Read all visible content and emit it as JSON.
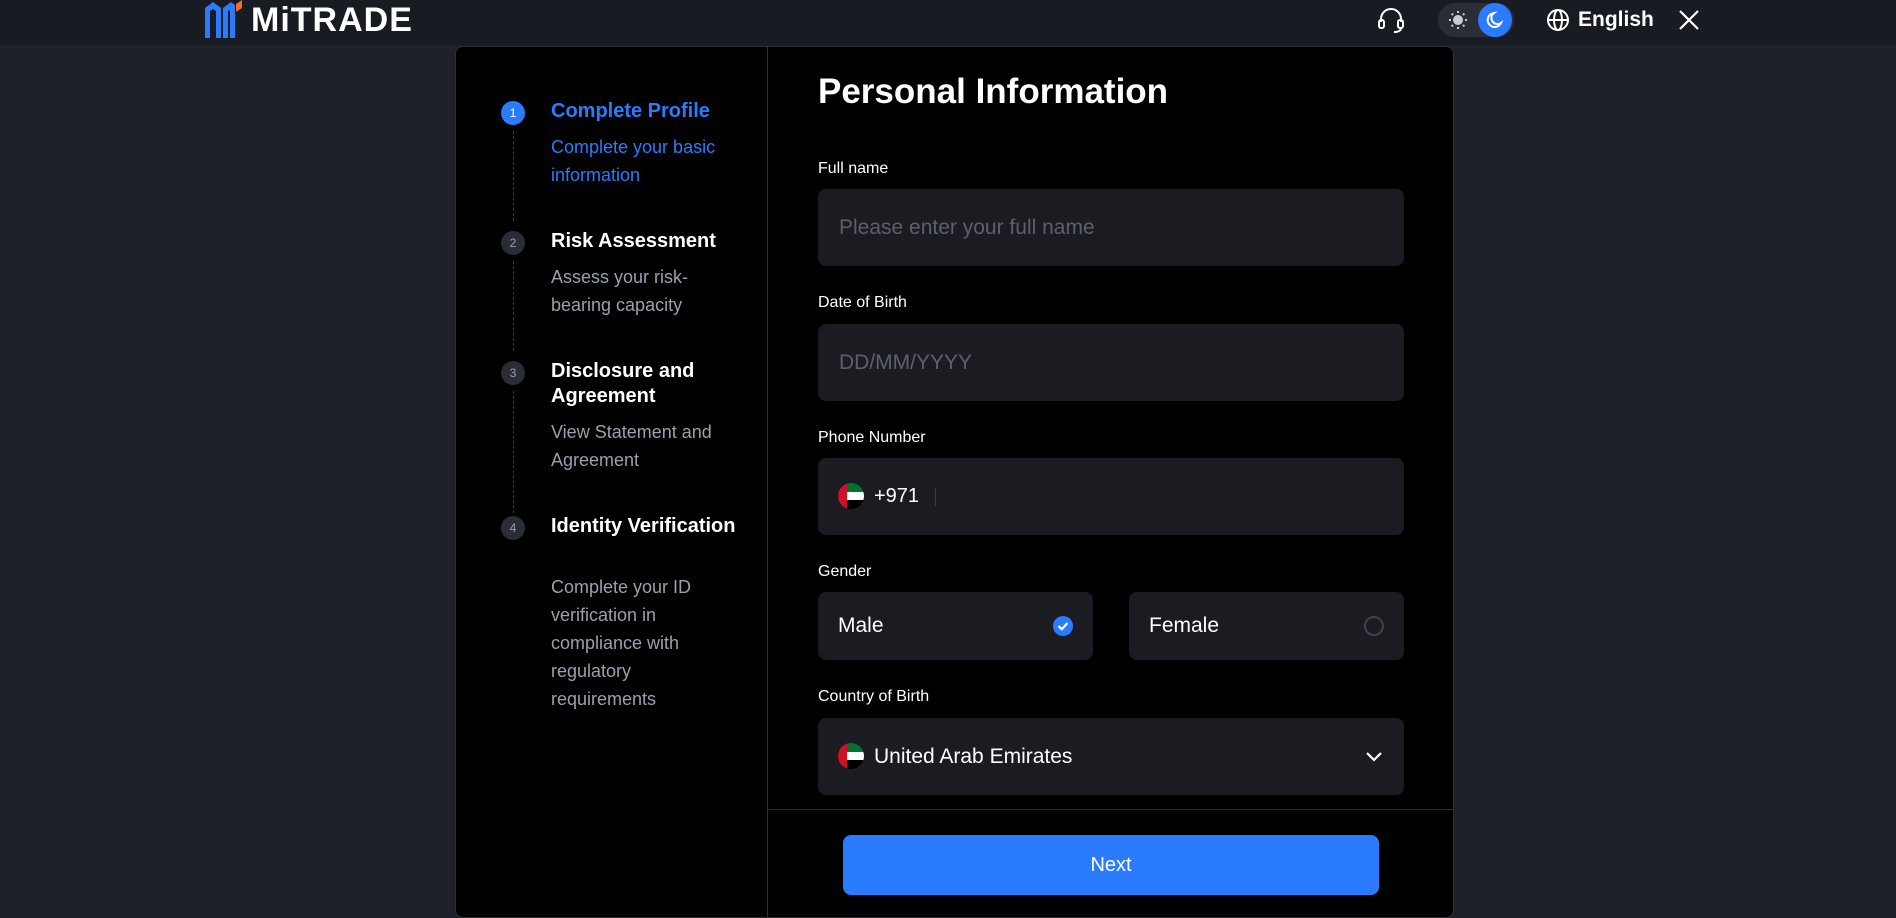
{
  "header": {
    "brand": "MiTRADE",
    "language": "English",
    "icons": {
      "logo": "mitrade-logo-icon",
      "support": "headset-icon",
      "light": "sun-icon",
      "dark": "moon-icon",
      "language": "globe-icon",
      "close": "close-icon"
    }
  },
  "steps": [
    {
      "number": "1",
      "title": "Complete Profile",
      "description": "Complete your basic information"
    },
    {
      "number": "2",
      "title": "Risk Assessment",
      "description": "Assess your risk-bearing capacity"
    },
    {
      "number": "3",
      "title": "Disclosure and Agreement",
      "description": "View Statement and Agreement"
    },
    {
      "number": "4",
      "title": "Identity Verification",
      "description": "Complete your ID verification in compliance with regulatory requirements"
    }
  ],
  "form": {
    "title": "Personal Information",
    "full_name": {
      "label": "Full name",
      "placeholder": "Please enter your full name",
      "value": ""
    },
    "dob": {
      "label": "Date of Birth",
      "placeholder": "DD/MM/YYYY",
      "value": ""
    },
    "phone": {
      "label": "Phone Number",
      "code": "+971",
      "value": ""
    },
    "gender": {
      "label": "Gender",
      "options": [
        "Male",
        "Female"
      ],
      "selected": "Male"
    },
    "country": {
      "label": "Country of Birth",
      "value": "United Arab Emirates"
    },
    "next_label": "Next"
  },
  "colors": {
    "accent": "#2b7bff",
    "background": "#1e2129",
    "card": "#000000",
    "field": "#1b1c22"
  }
}
